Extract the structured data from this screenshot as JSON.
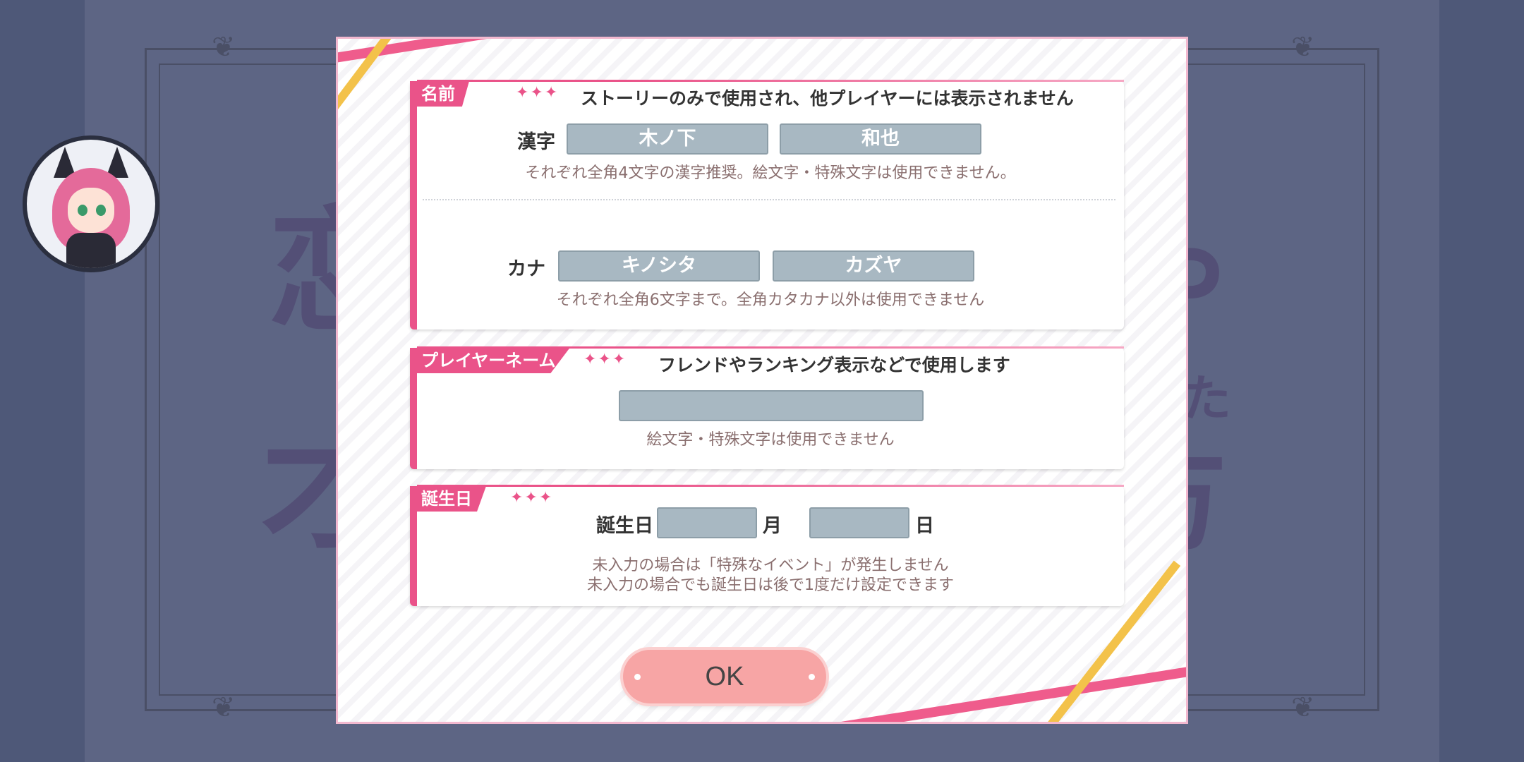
{
  "background": {
    "kanji": [
      "恋",
      "才",
      "や",
      "方",
      "た"
    ]
  },
  "dialog": {
    "name_section": {
      "tag": "名前",
      "description": "ストーリーのみで使用され、他プレイヤーには表示されません",
      "kanji_label": "漢字",
      "kanji_last": "木ノ下",
      "kanji_first": "和也",
      "kanji_hint": "それぞれ全角4文字の漢字推奨。絵文字・特殊文字は使用できません。",
      "kana_label": "カナ",
      "kana_last": "キノシタ",
      "kana_first": "カズヤ",
      "kana_hint": "それぞれ全角6文字まで。全角カタカナ以外は使用できません"
    },
    "player_section": {
      "tag": "プレイヤーネーム",
      "description": "フレンドやランキング表示などで使用します",
      "name_value": "",
      "hint": "絵文字・特殊文字は使用できません"
    },
    "birthday_section": {
      "tag": "誕生日",
      "label": "誕生日",
      "month_value": "",
      "month_unit": "月",
      "day_value": "",
      "day_unit": "日",
      "hint_line1": "未入力の場合は「特殊なイベント」が発生しません",
      "hint_line2": "未入力の場合でも誕生日は後で1度だけ設定できます"
    },
    "ok_label": "OK"
  },
  "colors": {
    "accent_pink": "#ea5389",
    "field_fill": "#a8b8c2",
    "ok_button": "#f7a5a5"
  }
}
